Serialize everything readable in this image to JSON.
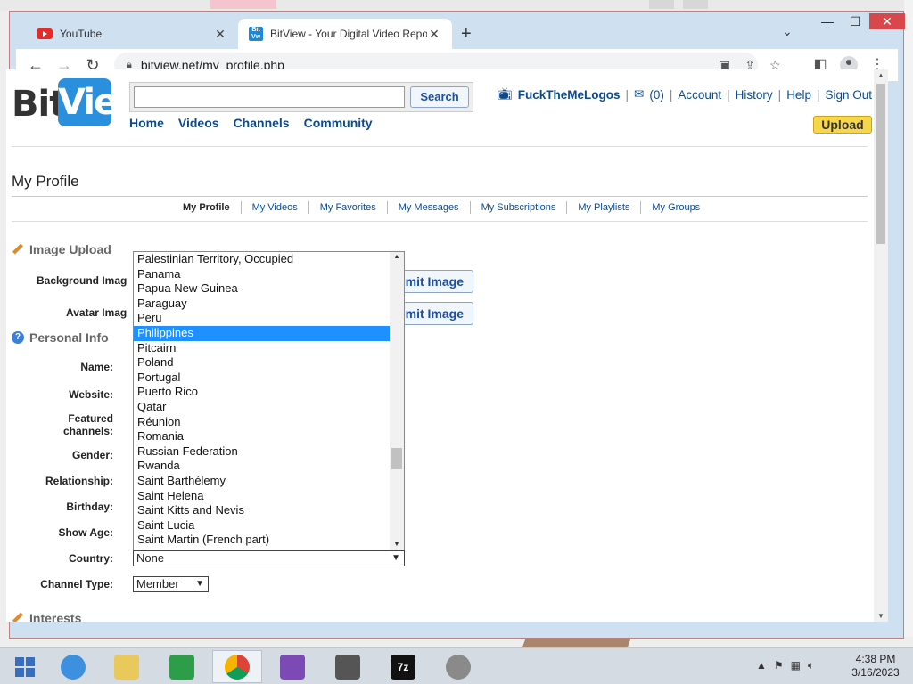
{
  "browser": {
    "tabs": [
      {
        "label": "YouTube",
        "icon": "youtube-icon"
      },
      {
        "label": "BitView - Your Digital Video Repository",
        "icon": "bitview-icon"
      }
    ],
    "url": "bitview.net/my_profile.php",
    "new_tab": "+",
    "window_controls": {
      "minimize": "—",
      "maximize": "☐",
      "close": "✕"
    }
  },
  "site": {
    "logo_left": "Bit",
    "logo_right": "View",
    "search": {
      "value": "",
      "button": "Search"
    },
    "nav": [
      "Home",
      "Videos",
      "Channels",
      "Community"
    ],
    "user": {
      "name": "FuckTheMeLogos",
      "messages": "(0)",
      "links": [
        "Account",
        "History",
        "Help",
        "Sign Out"
      ]
    },
    "upload_label": "Upload"
  },
  "page": {
    "title": "My Profile",
    "subnav": [
      "My Profile",
      "My Videos",
      "My Favorites",
      "My Messages",
      "My Subscriptions",
      "My Playlists",
      "My Groups"
    ],
    "image_upload": {
      "heading": "Image Upload",
      "background_label": "Background Imag",
      "avatar_label": "Avatar Imag",
      "submit_label": "ubmit Image"
    },
    "personal_info": {
      "heading": "Personal Info",
      "labels": {
        "name": "Name:",
        "website": "Website:",
        "featured_1": "Featured",
        "featured_2": "channels:",
        "gender": "Gender:",
        "relationship": "Relationship:",
        "birthday": "Birthday:",
        "show_age": "Show Age:",
        "country": "Country:",
        "channel_type": "Channel Type:"
      },
      "country_value": "None",
      "channel_type_value": "Member"
    },
    "interests_heading": "Interests"
  },
  "country_dropdown": {
    "options": [
      "Palestinian Territory, Occupied",
      "Panama",
      "Papua New Guinea",
      "Paraguay",
      "Peru",
      "Philippines",
      "Pitcairn",
      "Poland",
      "Portugal",
      "Puerto Rico",
      "Qatar",
      "Réunion",
      "Romania",
      "Russian Federation",
      "Rwanda",
      "Saint Barthélemy",
      "Saint Helena",
      "Saint Kitts and Nevis",
      "Saint Lucia",
      "Saint Martin (French part)"
    ],
    "highlighted": "Philippines"
  },
  "taskbar": {
    "time": "4:38 PM",
    "date": "3/16/2023",
    "apps": [
      "start-icon",
      "internet-explorer-icon",
      "file-explorer-icon",
      "store-icon",
      "chrome-icon",
      "visual-studio-icon",
      "computer-icon",
      "7zip-icon",
      "media-player-icon"
    ]
  },
  "colors": {
    "link": "#0c4a8e",
    "selection": "#1e90ff",
    "upload_button": "#f7d64a",
    "logo_blue": "#2a8fdc"
  }
}
